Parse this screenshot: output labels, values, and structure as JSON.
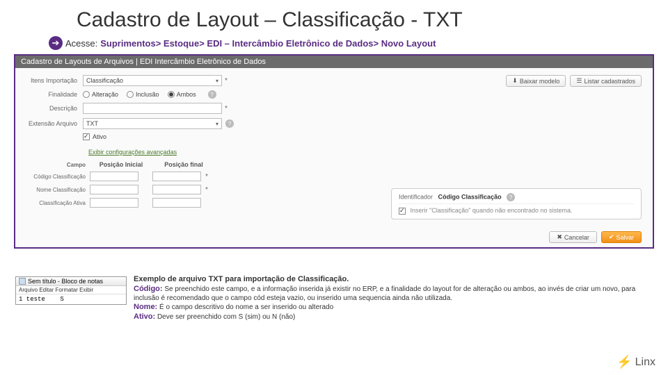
{
  "title": "Cadastro de Layout – Classificação - TXT",
  "access": {
    "label": "Acesse:",
    "path": "Suprimentos> Estoque> EDI – Intercâmbio Eletrônico de Dados> Novo Layout"
  },
  "panel": {
    "title": "Cadastro de Layouts de Arquivos | EDI  Intercâmbio Eletrônico de Dados"
  },
  "form": {
    "item_label": "Itens Importação",
    "item_value": "Classificação",
    "finalidade_label": "Finalidade",
    "opt_alteracao": "Alteração",
    "opt_inclusao": "Inclusão",
    "opt_ambos": "Ambos",
    "descricao_label": "Descrição",
    "ext_label": "Extensão Arquivo",
    "ext_value": "TXT",
    "ativo_label": "Ativo",
    "adv_link": "Exibir configurações avançadas"
  },
  "topbuttons": {
    "download": "Baixar modelo",
    "list": "Listar cadastrados"
  },
  "grid": {
    "col_campo": "Campo",
    "col_posini": "Posição Inicial",
    "col_posfin": "Posição final",
    "r1": "Código Classificação",
    "r2": "Nome Classificação",
    "r3": "Classificação Ativa"
  },
  "ident": {
    "head_label": "Identificador",
    "head_value": "Código Classificação",
    "line": "Inserir \"Classificação\" quando não encontrado no sistema."
  },
  "footer": {
    "cancel": "Cancelar",
    "save": "Salvar"
  },
  "notepad": {
    "title": "Sem título - Bloco de notas",
    "menu": "Arquivo  Editar  Formatar  Exibir",
    "body": "1 teste    S"
  },
  "desc": {
    "lead": "Exemplo de arquivo TXT para importação de Classificação.",
    "codigo_h": "Código:",
    "codigo_t": " Se preenchido este campo, e a informação inserida já existir no ERP, e a finalidade do layout for de alteração ou ambos, ao invés de criar um novo, para inclusão é recomendado que o campo cód esteja vazio, ou inserido uma sequencia ainda não utilizada.",
    "nome_h": "Nome:",
    "nome_t": " É o campo descritivo do nome a ser inserido ou alterado",
    "ativo_h": "Ativo:",
    "ativo_t": " Deve ser preenchido com S (sim) ou N (não)"
  },
  "logo": "Linx"
}
